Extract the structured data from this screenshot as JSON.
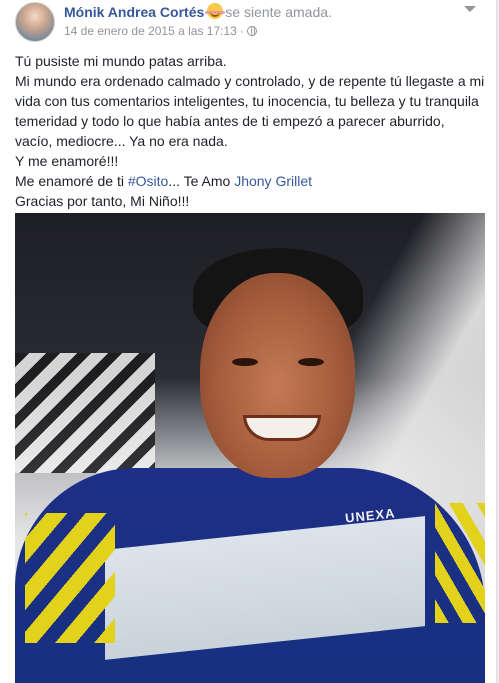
{
  "post": {
    "author": "Mónik Andrea Cortés",
    "feeling": "se siente amada.",
    "timestamp": "14 de enero de 2015 a las 17:13",
    "separator": "·",
    "paragraphs": {
      "p1": "Tú pusiste mi mundo patas arriba.",
      "p2": "Mi mundo era ordenado calmado y controlado, y de repente tú llegaste a mi vida con tus comentarios inteligentes, tu inocencia, tu belleza y tu tranquila temeridad y todo lo que había antes de ti empezó a parecer aburrido, vacío, mediocre... Ya no era nada.",
      "p3": "Y me enamoré!!!",
      "p4_prefix": "Me enamoré de ti ",
      "hashtag": "#Osito",
      "p4_mid": "... Te Amo ",
      "mention": "Jhony Grillet",
      "p5": "Gracias por tanto, Mi Niño!!!"
    },
    "icons": {
      "feeling": "smiling-face-icon",
      "privacy": "globe-icon",
      "menu": "chevron-down-icon"
    },
    "photo": {
      "shirt_text": "UNEXA"
    }
  },
  "colors": {
    "link": "#365899",
    "meta": "#90949c",
    "text": "#1d2129"
  }
}
